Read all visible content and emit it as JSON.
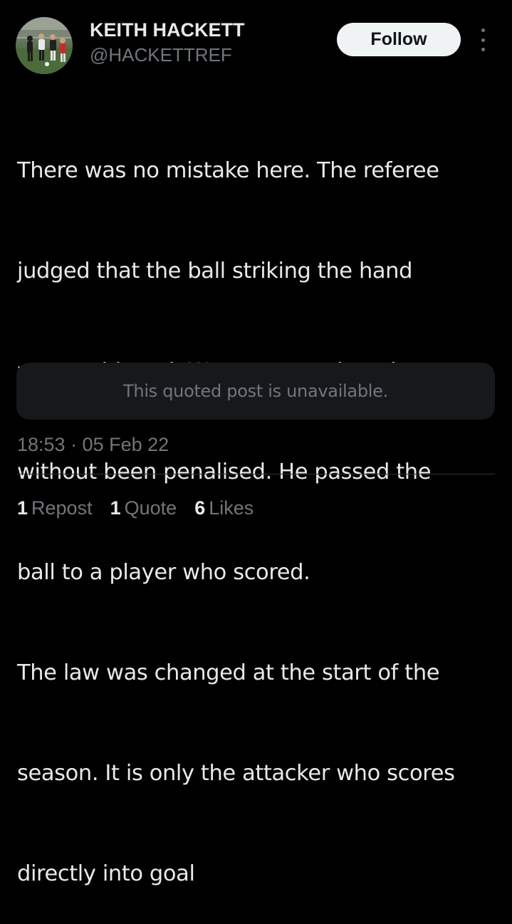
{
  "author": {
    "display_name": "KEITH HACKETT",
    "handle": "@HACKETTREF",
    "avatar_icon": "profile-photo-football-referee"
  },
  "actions": {
    "follow_label": "Follow",
    "more_icon": "vertical-ellipsis-icon"
  },
  "tweet": {
    "lines": [
      "There was no mistake here. The referee",
      "judged that the ball striking the hand",
      "was accidental. Watmore continued",
      "without been penalised. He passed the",
      "ball to a player who scored.",
      "The law was changed at the start of the",
      "season. It is only the attacker who scores",
      "directly into goal"
    ]
  },
  "quoted_post": {
    "text": "This quoted post is unavailable."
  },
  "meta": {
    "timestamp": "18:53 · 05 Feb 22"
  },
  "stats": [
    {
      "count": "1",
      "label": "Repost"
    },
    {
      "count": "1",
      "label": "Quote"
    },
    {
      "count": "6",
      "label": "Likes"
    }
  ],
  "colors": {
    "background": "#000000",
    "primary_text": "#e7e9ea",
    "secondary_text": "#71767b",
    "button_bg": "#eff3f4",
    "quote_bg": "#16181c",
    "divider": "#2f3336"
  }
}
